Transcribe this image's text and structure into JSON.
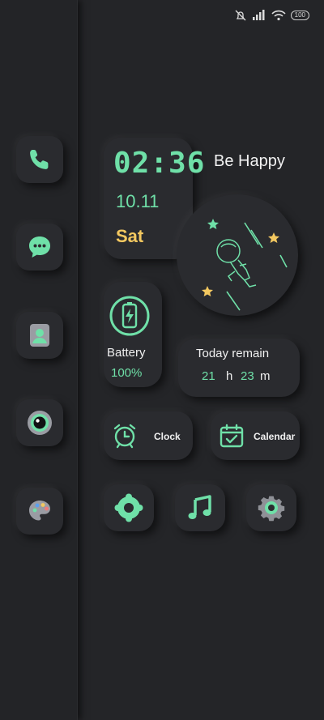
{
  "status_bar": {
    "battery_level": "100"
  },
  "time_widget": {
    "time": "02:36",
    "date": "10.11",
    "weekday": "Sat",
    "greeting": "Be Happy"
  },
  "battery_widget": {
    "label": "Battery",
    "value": "100%"
  },
  "remain_widget": {
    "label": "Today remain",
    "hours": "21",
    "hours_unit": "h",
    "minutes": "23",
    "minutes_unit": "m"
  },
  "app_buttons": {
    "clock_label": "Clock",
    "calendar_label": "Calendar"
  },
  "colors": {
    "accent": "#6fe0a8",
    "highlight": "#f3c860",
    "background": "#242528"
  }
}
